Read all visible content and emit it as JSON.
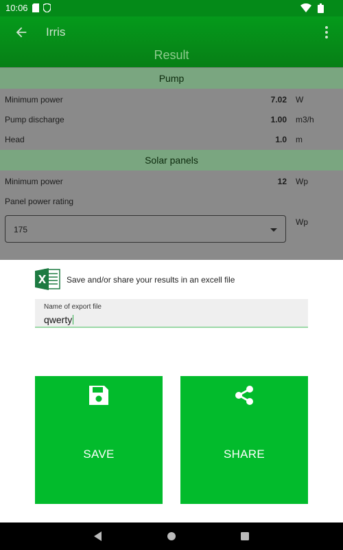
{
  "status_bar": {
    "time": "10:06",
    "icons": [
      "sd-card-icon",
      "shield-icon",
      "wifi-icon",
      "battery-icon"
    ]
  },
  "app_bar": {
    "title": "Irris",
    "subtitle": "Result",
    "back_icon": "arrow-back-icon",
    "menu_icon": "more-vert-icon"
  },
  "pump": {
    "header": "Pump",
    "rows": [
      {
        "label": "Minimum power",
        "value": "7.02",
        "unit": "W"
      },
      {
        "label": "Pump discharge",
        "value": "1.00",
        "unit": "m3/h"
      },
      {
        "label": "Head",
        "value": "1.0",
        "unit": "m"
      }
    ]
  },
  "solar": {
    "header": "Solar panels",
    "min_power": {
      "label": "Minimum power",
      "value": "12",
      "unit": "Wp"
    },
    "rating_label": "Panel power rating",
    "rating_selected": "175",
    "rating_unit": "Wp"
  },
  "export_sheet": {
    "message": "Save and/or share your results in an excell file",
    "field_label": "Name of export file",
    "field_value": "qwerty",
    "save_label": "SAVE",
    "share_label": "SHARE",
    "excel_icon": "excel-icon",
    "save_icon": "floppy-disk-icon",
    "share_icon": "share-icon"
  },
  "colors": {
    "status_bar": "#048a18",
    "app_bar": "#06901a",
    "button_green": "#02bb2c",
    "overlay_grey": "#8a8a8a"
  }
}
